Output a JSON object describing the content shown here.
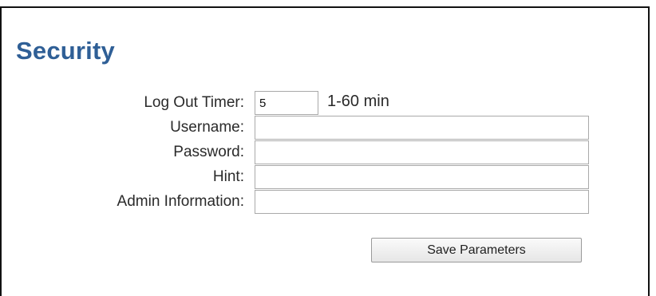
{
  "page": {
    "title": "Security"
  },
  "form": {
    "logout_timer": {
      "label": "Log Out Timer:",
      "value": "5",
      "note": "1-60 min"
    },
    "username": {
      "label": "Username:",
      "value": ""
    },
    "password": {
      "label": "Password:",
      "value": ""
    },
    "hint": {
      "label": "Hint:",
      "value": ""
    },
    "admin_information": {
      "label": "Admin Information:",
      "value": ""
    },
    "save_label": "Save Parameters"
  }
}
